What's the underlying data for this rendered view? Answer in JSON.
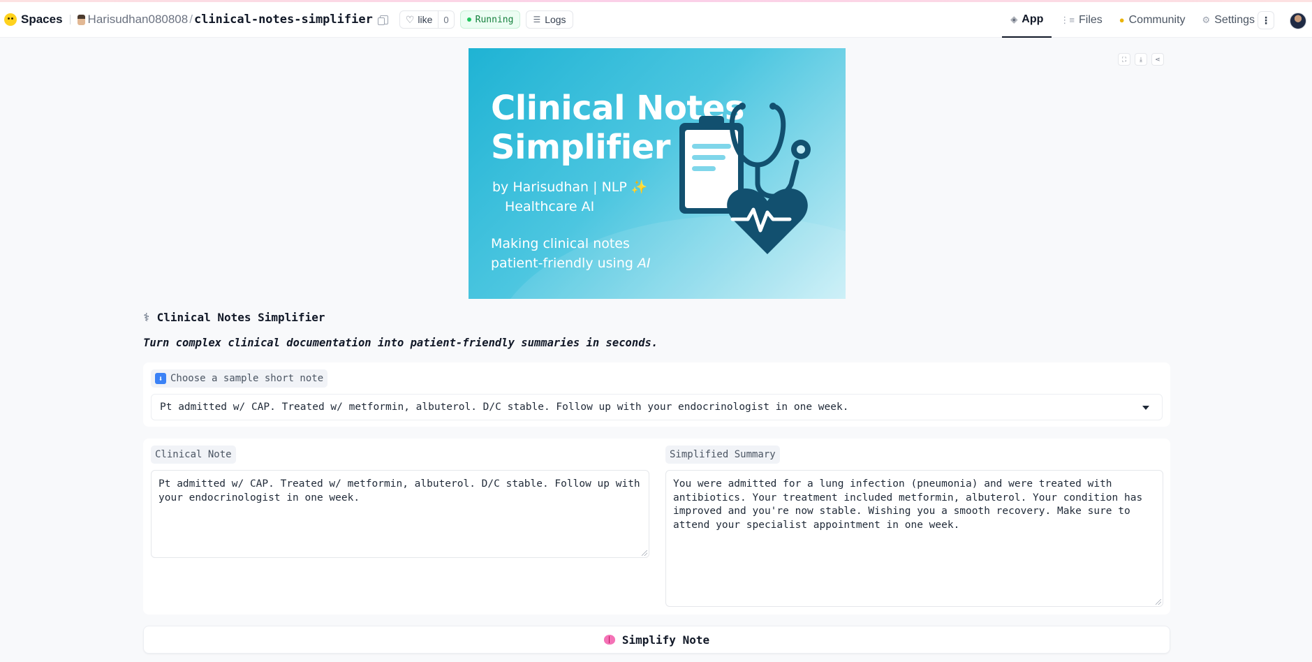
{
  "header": {
    "brand": "Spaces",
    "owner": "Harisudhan080808",
    "repo": "clinical-notes-simplifier",
    "like_label": "like",
    "like_count": "0",
    "status": "Running",
    "logs_label": "Logs",
    "nav": [
      {
        "label": "App",
        "icon": "cube-icon",
        "active": true
      },
      {
        "label": "Files",
        "icon": "files-icon",
        "active": false
      },
      {
        "label": "Community",
        "icon": "community-icon",
        "active": false
      },
      {
        "label": "Settings",
        "icon": "gear-icon",
        "active": false
      }
    ]
  },
  "banner": {
    "title_line1": "Clinical Notes",
    "title_line2": "Simplifier",
    "byline1": "by Harisudhan | NLP ✨",
    "byline2": "Healthcare AI",
    "tagline1": "Making clinical notes",
    "tagline2": "patient-friendly using ",
    "tagline_ai": "AI"
  },
  "app": {
    "title": "Clinical Notes Simplifier",
    "subtitle": "Turn complex clinical documentation into patient-friendly summaries in seconds.",
    "sample_label": "Choose a sample short note",
    "sample_value": "Pt admitted w/ CAP. Treated w/ metformin, albuterol. D/C stable. Follow up with your endocrinologist in one week.",
    "note_label": "Clinical Note",
    "note_value": "Pt admitted w/ CAP. Treated w/ metformin, albuterol. D/C stable. Follow up with your endocrinologist in one week.",
    "summary_label": "Simplified Summary",
    "summary_value": "You were admitted for a lung infection (pneumonia) and were treated with antibiotics. Your treatment included metformin, albuterol. Your condition has improved and you're now stable. Wishing you a smooth recovery. Make sure to attend your specialist appointment in one week.",
    "button_label": "Simplify Note"
  },
  "colors": {
    "banner_start": "#1fb3d4",
    "banner_end": "#c9eff7",
    "art_dark": "#12506f",
    "running_green": "#22c55e"
  }
}
